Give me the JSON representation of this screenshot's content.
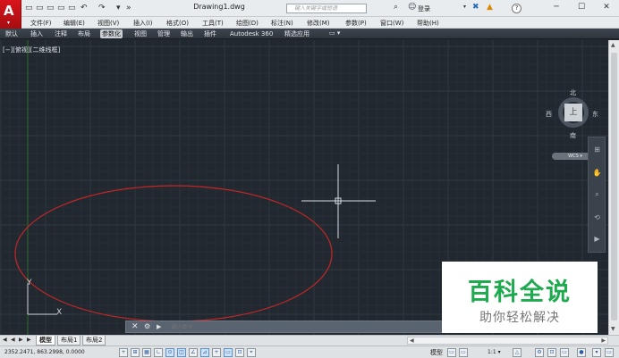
{
  "title_bar": {
    "document_title": "Drawing1.dwg",
    "search_placeholder": "键入关键字或短语",
    "login_label": "登录",
    "help": "?",
    "minimize": "─",
    "maximize": "☐",
    "close": "✕"
  },
  "app_button": {
    "logo": "A",
    "caret": "▾"
  },
  "quick_access": [
    "▭",
    "▭",
    "▭",
    "▭",
    "▭",
    "↶",
    "↷",
    "▾",
    "»"
  ],
  "menu": [
    "文件(F)",
    "编辑(E)",
    "视图(V)",
    "插入(I)",
    "格式(O)",
    "工具(T)",
    "绘图(D)",
    "标注(N)",
    "修改(M)",
    "参数(P)",
    "窗口(W)",
    "帮助(H)"
  ],
  "ribbon_tabs": [
    {
      "label": "默认",
      "active": false
    },
    {
      "label": "插入",
      "active": false
    },
    {
      "label": "注释",
      "active": false
    },
    {
      "label": "布局",
      "active": false
    },
    {
      "label": "参数化",
      "active": true
    },
    {
      "label": "视图",
      "active": false
    },
    {
      "label": "管理",
      "active": false
    },
    {
      "label": "输出",
      "active": false
    },
    {
      "label": "插件",
      "active": false
    },
    {
      "label": "Autodesk 360",
      "active": false
    },
    {
      "label": "精选应用",
      "active": false
    }
  ],
  "ribbon_toggle": "▭ ▾",
  "canvas": {
    "view_label": "[−][俯视][二维线框]",
    "ucs_y": "Y",
    "ucs_x": "X"
  },
  "viewcube": {
    "north": "北",
    "south": "南",
    "east": "东",
    "west": "西",
    "face": "上",
    "wcs": "WCS ▾"
  },
  "navbar_tools": [
    "⊞",
    "✋",
    "⌕",
    "⟲",
    "▶"
  ],
  "command_line": {
    "close": "✕",
    "wrench": "🔧",
    "prompt": "▶",
    "placeholder": "键入命令"
  },
  "watermark": {
    "title": "百科全说",
    "subtitle": "助你轻松解决"
  },
  "layout_tabs": {
    "nav": [
      "◀",
      "◀",
      "▶",
      "▶"
    ],
    "tabs": [
      {
        "label": "模型",
        "active": true
      },
      {
        "label": "布局1",
        "active": false
      },
      {
        "label": "布局2",
        "active": false
      }
    ]
  },
  "status_bar": {
    "coordinates": "2352.2471, 863.2998, 0.0000",
    "model": "模型",
    "scale": "1:1 ▾",
    "tools": [
      "+",
      "⊞",
      "▦",
      "∟",
      "⊙",
      "◫",
      "∠",
      "⊿",
      "+",
      "▭",
      "⊡",
      "⌖"
    ]
  },
  "colors": {
    "canvas_bg": "#212830",
    "grid_minor": "#272e36",
    "grid_major": "#2f3740",
    "ellipse": "#c62626",
    "ucs": "#d0d4d8",
    "crosshair": "#d8dde2",
    "watermark_green": "#1eaa4f"
  }
}
